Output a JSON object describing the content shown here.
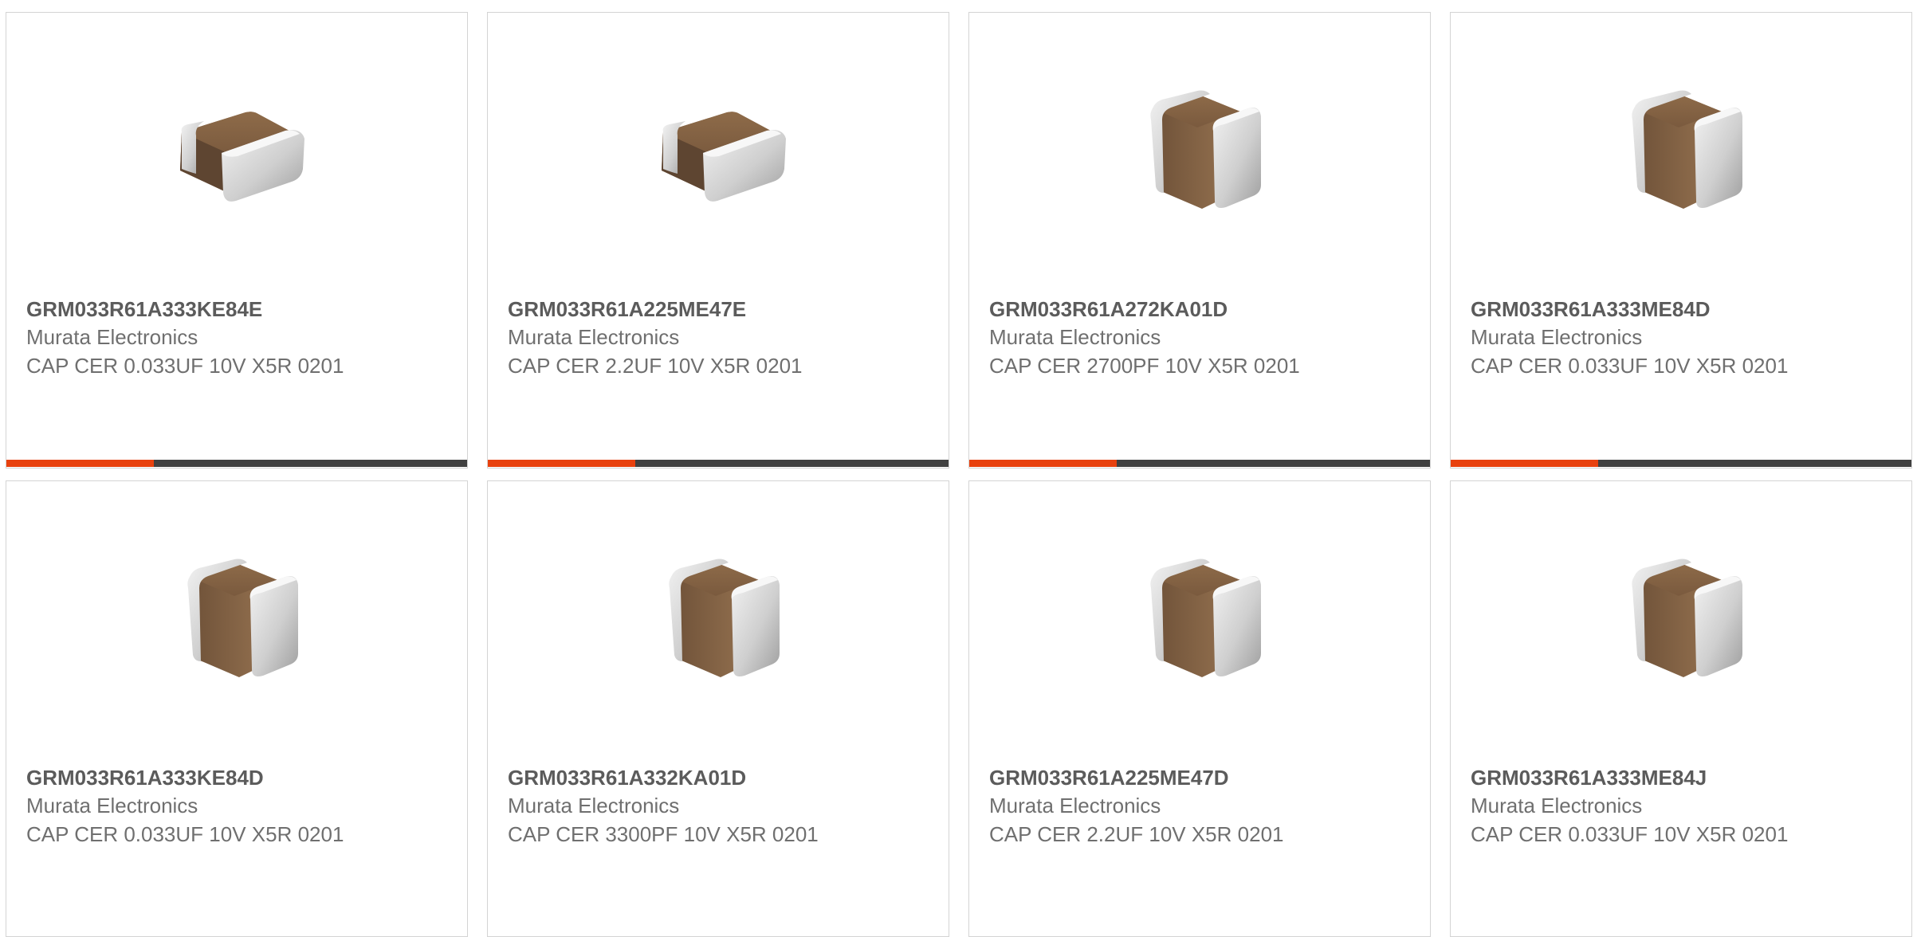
{
  "colors": {
    "accent": "#e8410e",
    "bar_track": "#404040",
    "part_text": "#5b5b5b",
    "secondary_text": "#6f6f6f",
    "card_border": "#d4d4d4"
  },
  "products": [
    {
      "part": "GRM033R61A333KE84E",
      "manufacturer": "Murata Electronics",
      "description": "CAP CER 0.033UF 10V X5R 0201",
      "image": "ceramic-capacitor-flat-icon",
      "progress": 0.32
    },
    {
      "part": "GRM033R61A225ME47E",
      "manufacturer": "Murata Electronics",
      "description": "CAP CER 2.2UF 10V X5R 0201",
      "image": "ceramic-capacitor-flat-icon",
      "progress": 0.32
    },
    {
      "part": "GRM033R61A272KA01D",
      "manufacturer": "Murata Electronics",
      "description": "CAP CER 2700PF 10V X5R 0201",
      "image": "ceramic-capacitor-tall-icon",
      "progress": 0.32
    },
    {
      "part": "GRM033R61A333ME84D",
      "manufacturer": "Murata Electronics",
      "description": "CAP CER 0.033UF 10V X5R 0201",
      "image": "ceramic-capacitor-tall-icon",
      "progress": 0.32
    },
    {
      "part": "GRM033R61A333KE84D",
      "manufacturer": "Murata Electronics",
      "description": "CAP CER 0.033UF 10V X5R 0201",
      "image": "ceramic-capacitor-tall-icon",
      "progress": null
    },
    {
      "part": "GRM033R61A332KA01D",
      "manufacturer": "Murata Electronics",
      "description": "CAP CER 3300PF 10V X5R 0201",
      "image": "ceramic-capacitor-tall-icon",
      "progress": null
    },
    {
      "part": "GRM033R61A225ME47D",
      "manufacturer": "Murata Electronics",
      "description": "CAP CER 2.2UF 10V X5R 0201",
      "image": "ceramic-capacitor-tall-icon",
      "progress": null
    },
    {
      "part": "GRM033R61A333ME84J",
      "manufacturer": "Murata Electronics",
      "description": "CAP CER 0.033UF 10V X5R 0201",
      "image": "ceramic-capacitor-tall-icon",
      "progress": null
    }
  ]
}
